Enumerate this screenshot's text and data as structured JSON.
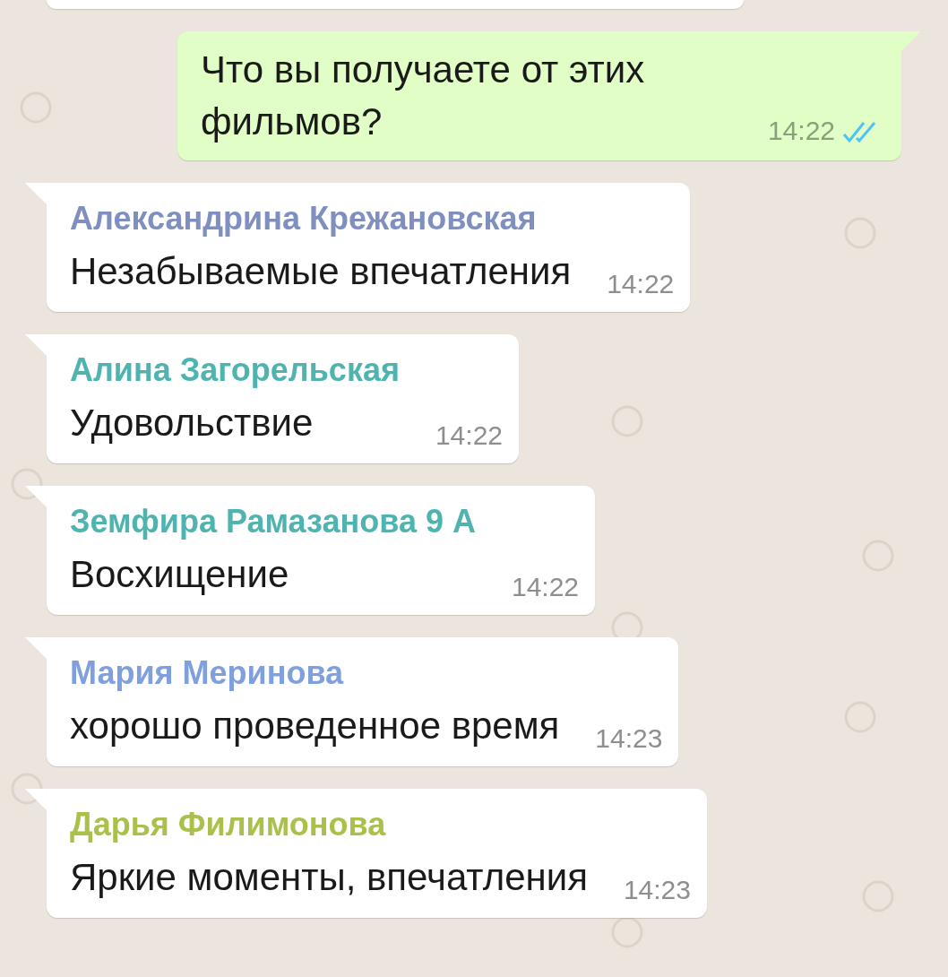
{
  "outgoing": {
    "text": "Что вы получаете от этих фильмов?",
    "time": "14:22",
    "read": true
  },
  "messages": [
    {
      "sender": "Александрина Крежановская",
      "color": "#7f8fbf",
      "text": "Незабываемые впечатления",
      "time": "14:22"
    },
    {
      "sender": "Алина Загорельская",
      "color": "#4fb3b0",
      "text": "Удовольствие",
      "time": "14:22"
    },
    {
      "sender": "Земфира Рамазанова 9 А",
      "color": "#4fb3b0",
      "text": "Восхищение",
      "time": "14:22"
    },
    {
      "sender": "Мария Меринова",
      "color": "#7f9fdf",
      "text": "хорошо проведенное время",
      "time": "14:23"
    },
    {
      "sender": "Дарья Филимонова",
      "color": "#a9c14a",
      "text": "Яркие моменты, впечатления",
      "time": "14:23"
    }
  ]
}
